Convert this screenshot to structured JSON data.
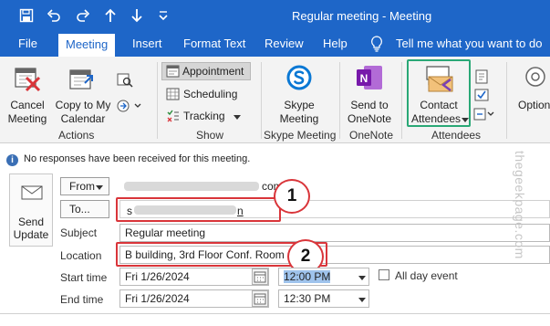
{
  "window": {
    "title": "Regular meeting  -  Meeting"
  },
  "quick_access": [
    "save-icon",
    "undo-icon",
    "redo-icon",
    "arrow-up-icon",
    "arrow-down-icon",
    "customize-chevron-icon"
  ],
  "menu": {
    "tabs": [
      "File",
      "Meeting",
      "Insert",
      "Format Text",
      "Review",
      "Help"
    ],
    "active": "Meeting",
    "tell_me": "Tell me what you want to do"
  },
  "ribbon": {
    "actions": {
      "cancel_line1": "Cancel",
      "cancel_line2": "Meeting",
      "copy_line1": "Copy to My",
      "copy_line2": "Calendar",
      "group": "Actions"
    },
    "show": {
      "appointment": "Appointment",
      "scheduling": "Scheduling",
      "tracking": "Tracking",
      "group": "Show"
    },
    "skype": {
      "line1": "Skype",
      "line2": "Meeting",
      "group": "Skype Meeting"
    },
    "onenote": {
      "line1": "Send to",
      "line2": "OneNote",
      "group": "OneNote"
    },
    "attendees": {
      "line1": "Contact",
      "line2": "Attendees",
      "group": "Attendees"
    },
    "options": {
      "label": "Option"
    }
  },
  "info": {
    "message": "No responses have been received for this meeting."
  },
  "form": {
    "send_update_line1": "Send",
    "send_update_line2": "Update",
    "from_label": "From",
    "from_value_suffix": "com",
    "to_button": "To...",
    "to_value_prefix": "s",
    "to_value_suffix": "n",
    "subject_label": "Subject",
    "subject_value": "Regular meeting",
    "location_label": "Location",
    "location_value": "B building, 3rd Floor Conf. Room",
    "start_label": "Start time",
    "start_date": "Fri 1/26/2024",
    "start_time": "12:00 PM",
    "end_label": "End time",
    "end_date": "Fri 1/26/2024",
    "end_time": "12:30 PM",
    "all_day": "All day event"
  },
  "callouts": [
    "1",
    "2"
  ],
  "watermark": "thegeekpage.com",
  "colors": {
    "titlebar": "#1e66c8",
    "highlight_red": "#d9353a",
    "highlight_green": "#2aa876"
  }
}
